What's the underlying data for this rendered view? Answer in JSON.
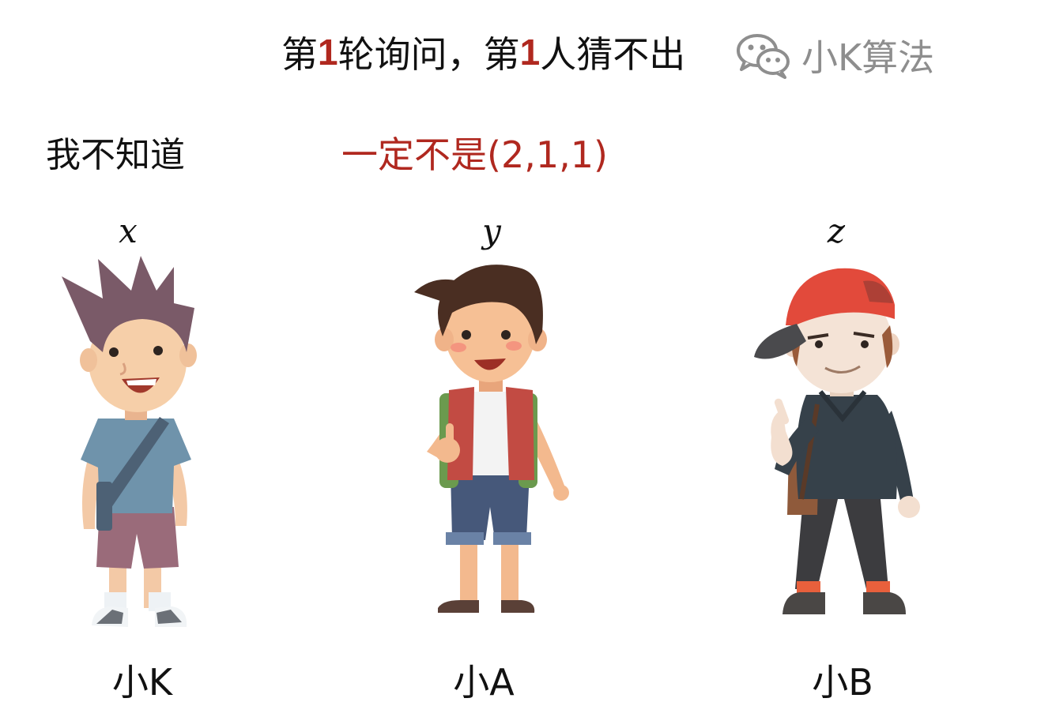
{
  "header": {
    "title_parts": [
      "第",
      "1",
      "轮询问，第",
      "1",
      "人猜不出"
    ],
    "brand": "小K算法",
    "brand_icon": "wechat-icon"
  },
  "statement": {
    "speech": "我不知道",
    "conclusion": "一定不是(2,1,1)"
  },
  "people": [
    {
      "variable": "x",
      "name": "小K"
    },
    {
      "variable": "y",
      "name": "小A"
    },
    {
      "variable": "z",
      "name": "小B"
    }
  ],
  "colors": {
    "accent": "#b0281f",
    "brand_gray": "#8e8e8e"
  }
}
